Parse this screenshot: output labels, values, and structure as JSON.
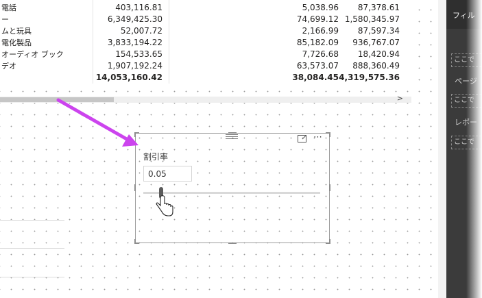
{
  "table": {
    "rows": [
      {
        "name": "電話",
        "v1": "403,116.81",
        "v2": "5,038.96",
        "v3": "87,378.61"
      },
      {
        "name": "ー",
        "v1": "6,349,425.30",
        "v2": "74,699.12",
        "v3": "1,580,345.97"
      },
      {
        "name": "ムと玩具",
        "v1": "52,007.72",
        "v2": "2,166.99",
        "v3": "87,597.34"
      },
      {
        "name": "電化製品",
        "v1": "3,833,194.22",
        "v2": "85,182.09",
        "v3": "936,767.07"
      },
      {
        "name": "オーディオ ブック",
        "v1": "154,533.65",
        "v2": "7,726.68",
        "v3": "18,420.94"
      },
      {
        "name": "デオ",
        "v1": "1,907,192.24",
        "v2": "63,573.07",
        "v3": "888,360.49"
      }
    ],
    "total": {
      "name": "",
      "v1": "14,053,160.42",
      "v2": "38,084.45",
      "v3": "4,319,575.36"
    },
    "scroll_arrow": ">"
  },
  "slicer": {
    "title": "割引率",
    "value": "0.05",
    "slider_fraction": 0.1,
    "focus_icon": "focus-mode-icon",
    "more_icon": "more-options-icon"
  },
  "filter_pane": {
    "title": "フィル",
    "drop1": "ここで",
    "label_page": "ページ",
    "drop2": "ここで",
    "label_report": "レポー",
    "drop3": "ここで"
  },
  "colors": {
    "arrow": "#cc44ee",
    "pane_bg": "#3b3b3b",
    "slider_thumb": "#5b5b5b"
  }
}
